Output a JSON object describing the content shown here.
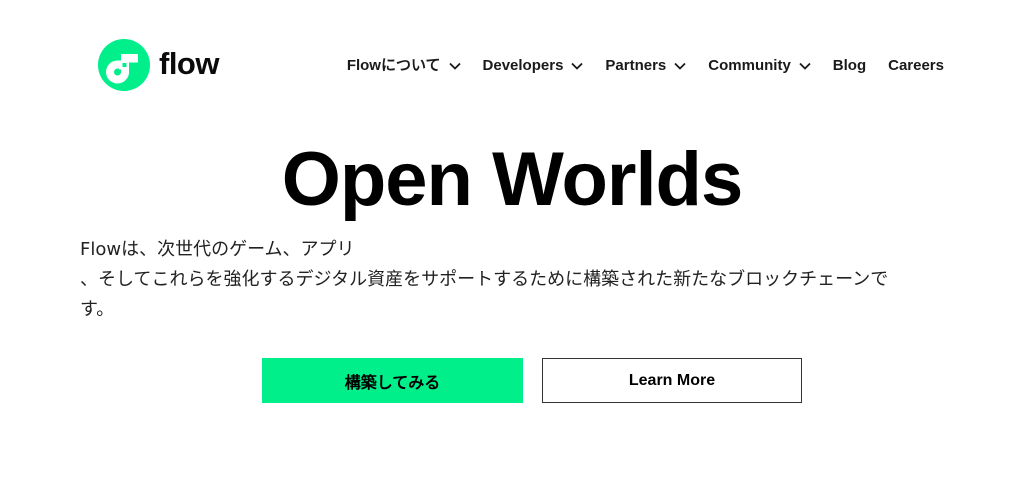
{
  "brand": {
    "name": "flow",
    "accent_color": "#00ef8b",
    "logo_icon": "flow-logo-icon"
  },
  "nav": {
    "items": [
      {
        "label": "Flowについて",
        "has_dropdown": true
      },
      {
        "label": "Developers",
        "has_dropdown": true
      },
      {
        "label": "Partners",
        "has_dropdown": true
      },
      {
        "label": "Community",
        "has_dropdown": true
      },
      {
        "label": "Blog",
        "has_dropdown": false
      },
      {
        "label": "Careers",
        "has_dropdown": false
      }
    ],
    "dropdown_icon": "chevron-down-icon"
  },
  "hero": {
    "title": "Open Worlds",
    "description_lines": [
      "Flowは、次世代のゲーム、アプリ",
      "、そしてこれらを強化するデジタル資産をサポートするために構築された新たなブロックチェーンで",
      "す。"
    ]
  },
  "buttons": {
    "primary_label": "構築してみる",
    "secondary_label": "Learn More"
  }
}
